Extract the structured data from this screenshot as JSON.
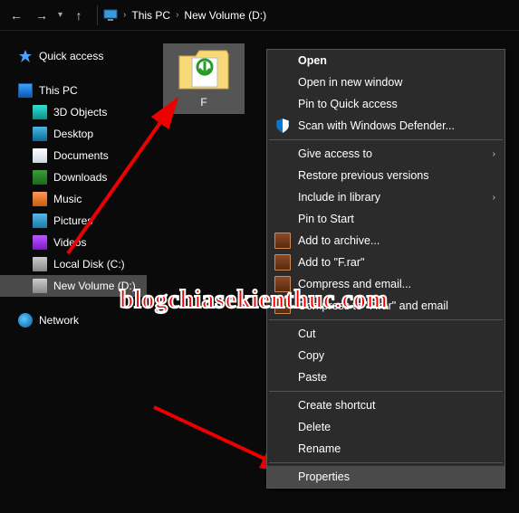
{
  "toolbar": {
    "back": "←",
    "forward": "→",
    "up": "↑",
    "crumb_root": "This PC",
    "crumb_current": "New Volume (D:)"
  },
  "sidebar": {
    "quick_access": "Quick access",
    "this_pc": "This PC",
    "items": [
      {
        "label": "3D Objects"
      },
      {
        "label": "Desktop"
      },
      {
        "label": "Documents"
      },
      {
        "label": "Downloads"
      },
      {
        "label": "Music"
      },
      {
        "label": "Pictures"
      },
      {
        "label": "Videos"
      },
      {
        "label": "Local Disk (C:)"
      },
      {
        "label": "New Volume (D:)"
      }
    ],
    "network": "Network"
  },
  "content": {
    "folder_name": "F"
  },
  "context_menu": {
    "open": "Open",
    "open_new": "Open in new window",
    "pin_quick": "Pin to Quick access",
    "scan_defender": "Scan with Windows Defender...",
    "give_access": "Give access to",
    "restore": "Restore previous versions",
    "include_lib": "Include in library",
    "pin_start": "Pin to Start",
    "add_archive": "Add to archive...",
    "add_rar": "Add to \"F.rar\"",
    "compress_email": "Compress and email...",
    "compress_rar_email": "Compress to \"F.rar\" and email",
    "cut": "Cut",
    "copy": "Copy",
    "paste": "Paste",
    "shortcut": "Create shortcut",
    "delete": "Delete",
    "rename": "Rename",
    "properties": "Properties"
  },
  "watermark": "blogchiasekienthuc.com"
}
